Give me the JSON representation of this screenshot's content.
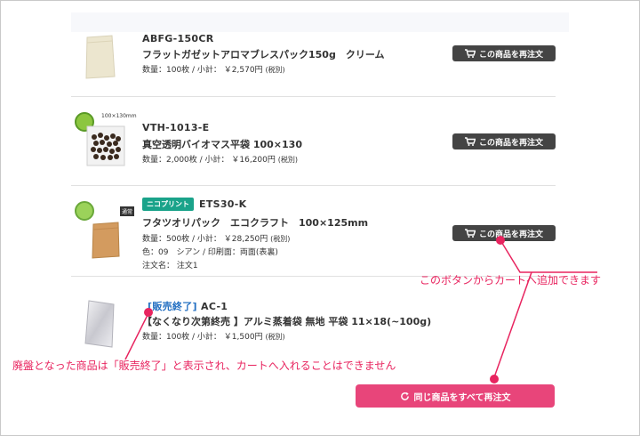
{
  "orders": [
    {
      "sku": "ABFG-150CR",
      "name": "フラットガゼットアロマブレスパック150g　クリーム",
      "meta1": "数量：100枚 / 小計： ￥2,570円",
      "tax": "(税別)",
      "button": "この商品を再注文"
    },
    {
      "size_tag": "100×130mm",
      "sku": "VTH-1013-E",
      "name": "真空透明バイオマス平袋 100×130",
      "meta1": "数量：2,000枚 / 小計： ￥16,200円",
      "tax": "(税別)",
      "button": "この商品を再注文"
    },
    {
      "badge": "ニコプリント",
      "small_label": "通常",
      "sku": "ETS30-K",
      "name": "フタツオリパック　エコクラフト　100×125mm",
      "meta1": "数量：500枚 / 小計： ￥28,250円",
      "tax": "(税別)",
      "meta2": "色：09　シアン / 印刷面：両面(表裏)",
      "meta3": "注文名： 注文1",
      "button": "この商品を再注文"
    },
    {
      "ended_label": "[販売終了]",
      "sku": "AC-1",
      "name": "【なくなり次第終売 】アルミ蒸着袋 無地 平袋 11×18(~100g)",
      "meta1": "数量：100枚 / 小計： ￥1,500円",
      "tax": "(税別)"
    }
  ],
  "reorder_all_label": "同じ商品をすべて再注文",
  "annotations": {
    "button_note": "このボタンからカートへ追加できます",
    "discontinued_note": "廃盤となった商品は「販売終了」と表示され、カートへ入れることはできません"
  },
  "colors": {
    "accent_pink": "#e8457a",
    "annotation_pink": "#e8245f",
    "button_dark": "#444444",
    "badge_green": "#1aa38a",
    "ended_blue": "#2470c2"
  },
  "icons": {
    "reorder": "cart-icon",
    "reorder_all": "refresh-icon"
  }
}
